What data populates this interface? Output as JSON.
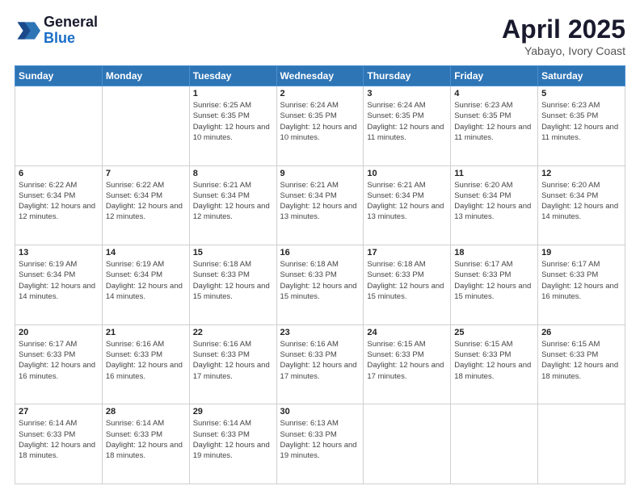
{
  "logo": {
    "general": "General",
    "blue": "Blue"
  },
  "title": {
    "month": "April 2025",
    "location": "Yabayo, Ivory Coast"
  },
  "weekdays": [
    "Sunday",
    "Monday",
    "Tuesday",
    "Wednesday",
    "Thursday",
    "Friday",
    "Saturday"
  ],
  "weeks": [
    [
      {
        "day": "",
        "info": ""
      },
      {
        "day": "",
        "info": ""
      },
      {
        "day": "1",
        "info": "Sunrise: 6:25 AM\nSunset: 6:35 PM\nDaylight: 12 hours and 10 minutes."
      },
      {
        "day": "2",
        "info": "Sunrise: 6:24 AM\nSunset: 6:35 PM\nDaylight: 12 hours and 10 minutes."
      },
      {
        "day": "3",
        "info": "Sunrise: 6:24 AM\nSunset: 6:35 PM\nDaylight: 12 hours and 11 minutes."
      },
      {
        "day": "4",
        "info": "Sunrise: 6:23 AM\nSunset: 6:35 PM\nDaylight: 12 hours and 11 minutes."
      },
      {
        "day": "5",
        "info": "Sunrise: 6:23 AM\nSunset: 6:35 PM\nDaylight: 12 hours and 11 minutes."
      }
    ],
    [
      {
        "day": "6",
        "info": "Sunrise: 6:22 AM\nSunset: 6:34 PM\nDaylight: 12 hours and 12 minutes."
      },
      {
        "day": "7",
        "info": "Sunrise: 6:22 AM\nSunset: 6:34 PM\nDaylight: 12 hours and 12 minutes."
      },
      {
        "day": "8",
        "info": "Sunrise: 6:21 AM\nSunset: 6:34 PM\nDaylight: 12 hours and 12 minutes."
      },
      {
        "day": "9",
        "info": "Sunrise: 6:21 AM\nSunset: 6:34 PM\nDaylight: 12 hours and 13 minutes."
      },
      {
        "day": "10",
        "info": "Sunrise: 6:21 AM\nSunset: 6:34 PM\nDaylight: 12 hours and 13 minutes."
      },
      {
        "day": "11",
        "info": "Sunrise: 6:20 AM\nSunset: 6:34 PM\nDaylight: 12 hours and 13 minutes."
      },
      {
        "day": "12",
        "info": "Sunrise: 6:20 AM\nSunset: 6:34 PM\nDaylight: 12 hours and 14 minutes."
      }
    ],
    [
      {
        "day": "13",
        "info": "Sunrise: 6:19 AM\nSunset: 6:34 PM\nDaylight: 12 hours and 14 minutes."
      },
      {
        "day": "14",
        "info": "Sunrise: 6:19 AM\nSunset: 6:34 PM\nDaylight: 12 hours and 14 minutes."
      },
      {
        "day": "15",
        "info": "Sunrise: 6:18 AM\nSunset: 6:33 PM\nDaylight: 12 hours and 15 minutes."
      },
      {
        "day": "16",
        "info": "Sunrise: 6:18 AM\nSunset: 6:33 PM\nDaylight: 12 hours and 15 minutes."
      },
      {
        "day": "17",
        "info": "Sunrise: 6:18 AM\nSunset: 6:33 PM\nDaylight: 12 hours and 15 minutes."
      },
      {
        "day": "18",
        "info": "Sunrise: 6:17 AM\nSunset: 6:33 PM\nDaylight: 12 hours and 15 minutes."
      },
      {
        "day": "19",
        "info": "Sunrise: 6:17 AM\nSunset: 6:33 PM\nDaylight: 12 hours and 16 minutes."
      }
    ],
    [
      {
        "day": "20",
        "info": "Sunrise: 6:17 AM\nSunset: 6:33 PM\nDaylight: 12 hours and 16 minutes."
      },
      {
        "day": "21",
        "info": "Sunrise: 6:16 AM\nSunset: 6:33 PM\nDaylight: 12 hours and 16 minutes."
      },
      {
        "day": "22",
        "info": "Sunrise: 6:16 AM\nSunset: 6:33 PM\nDaylight: 12 hours and 17 minutes."
      },
      {
        "day": "23",
        "info": "Sunrise: 6:16 AM\nSunset: 6:33 PM\nDaylight: 12 hours and 17 minutes."
      },
      {
        "day": "24",
        "info": "Sunrise: 6:15 AM\nSunset: 6:33 PM\nDaylight: 12 hours and 17 minutes."
      },
      {
        "day": "25",
        "info": "Sunrise: 6:15 AM\nSunset: 6:33 PM\nDaylight: 12 hours and 18 minutes."
      },
      {
        "day": "26",
        "info": "Sunrise: 6:15 AM\nSunset: 6:33 PM\nDaylight: 12 hours and 18 minutes."
      }
    ],
    [
      {
        "day": "27",
        "info": "Sunrise: 6:14 AM\nSunset: 6:33 PM\nDaylight: 12 hours and 18 minutes."
      },
      {
        "day": "28",
        "info": "Sunrise: 6:14 AM\nSunset: 6:33 PM\nDaylight: 12 hours and 18 minutes."
      },
      {
        "day": "29",
        "info": "Sunrise: 6:14 AM\nSunset: 6:33 PM\nDaylight: 12 hours and 19 minutes."
      },
      {
        "day": "30",
        "info": "Sunrise: 6:13 AM\nSunset: 6:33 PM\nDaylight: 12 hours and 19 minutes."
      },
      {
        "day": "",
        "info": ""
      },
      {
        "day": "",
        "info": ""
      },
      {
        "day": "",
        "info": ""
      }
    ]
  ]
}
